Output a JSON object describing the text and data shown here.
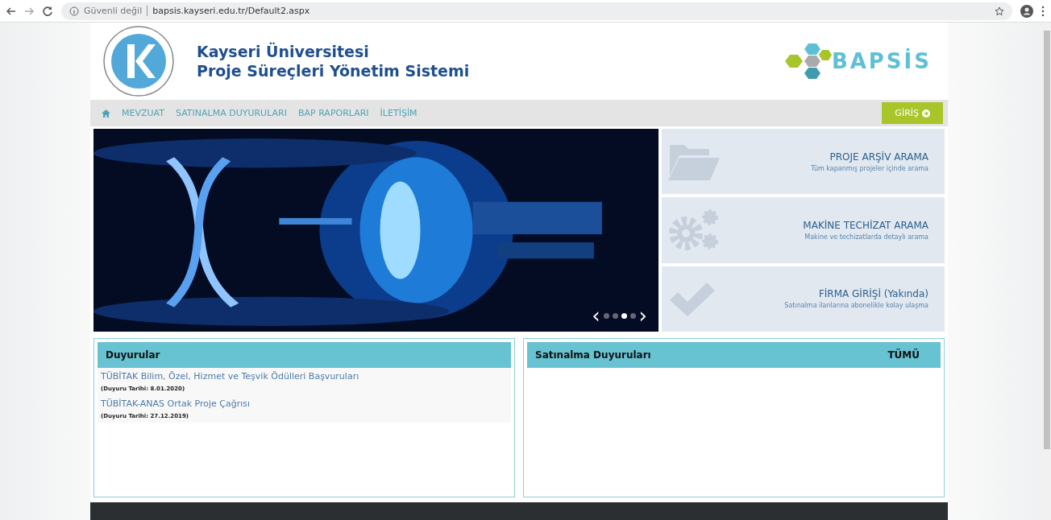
{
  "browser": {
    "security": "Güvenli değil",
    "url": "bapsis.kayseri.edu.tr/Default2.aspx"
  },
  "header": {
    "title_line1": "Kayseri Üniversitesi",
    "title_line2": "Proje Süreçleri Yönetim Sistemi",
    "logo_text": "BAPSİS"
  },
  "nav": {
    "items": [
      "MEVZUAT",
      "SATINALMA DUYURULARI",
      "BAP RAPORLARI",
      "İLETİŞİM"
    ],
    "login": "GİRİŞ"
  },
  "carousel": {
    "prev": "‹",
    "next": "›",
    "slides": [
      {
        "selected": false
      },
      {
        "selected": false
      },
      {
        "selected": true
      },
      {
        "selected": false
      }
    ]
  },
  "cards": [
    {
      "kind": "folder",
      "title": "PROJE ARŞİV ARAMA",
      "subtitle": "Tüm kapanmış projeler içinde arama"
    },
    {
      "kind": "gears",
      "title": "MAKİNE TECHİZAT ARAMA",
      "subtitle": "Makine ve techizatlarda detaylı arama"
    },
    {
      "kind": "check",
      "title": "FİRMA GİRİŞİ (Yakında)",
      "subtitle": "Satınalma ilanlarına abonelikle kolay ulaşma"
    }
  ],
  "announcements": {
    "title": "Duyurular",
    "items": [
      {
        "title": "TÜBİTAK Bilim, Özel, Hizmet ve Teşvik Ödülleri Başvuruları",
        "date": "(Duyuru Tarihi: 8.01.2020)"
      },
      {
        "title": "TÜBİTAK-ANAS Ortak Proje Çağrısı",
        "date": "(Duyuru Tarihi: 27.12.2019)"
      }
    ]
  },
  "purchases": {
    "title": "Satınalma Duyuruları",
    "all": "TÜMÜ"
  }
}
